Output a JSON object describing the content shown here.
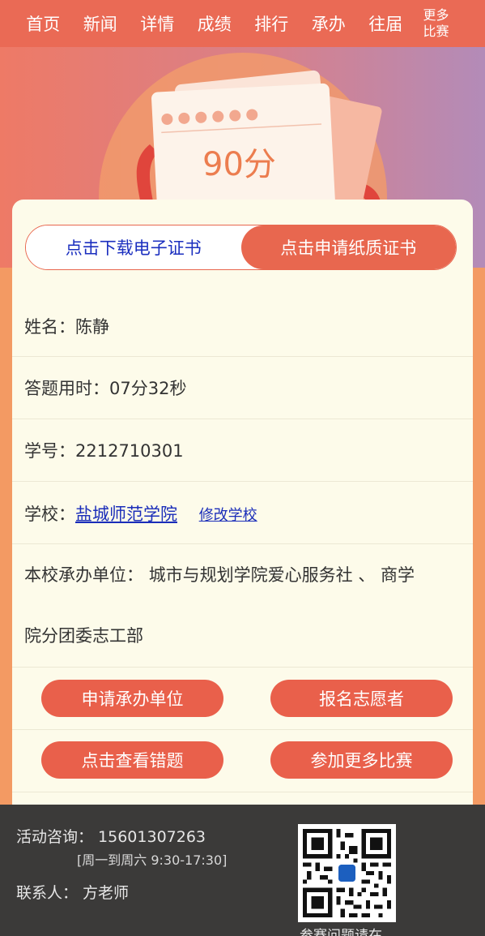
{
  "nav": {
    "items": [
      "首页",
      "新闻",
      "详情",
      "成绩",
      "排行",
      "承办",
      "往届"
    ],
    "more_line1": "更多",
    "more_line2": "比赛"
  },
  "hero": {
    "score": "90分"
  },
  "cert": {
    "download_label": "点击下载电子证书",
    "apply_label": "点击申请纸质证书"
  },
  "info": {
    "name_label": "姓名：",
    "name_value": "陈静",
    "time_label": "答题用时：",
    "time_value": "07分32秒",
    "id_label": "学号：",
    "id_value": "2212710301",
    "school_label": "学校：",
    "school_value": "盐城师范学院",
    "edit_school": "修改学校",
    "host_label": "本校承办单位：",
    "host_line1_value": "城市与规划学院爱心服务社 、 商学",
    "host_line2_value": "院分团委志工部"
  },
  "actions": {
    "apply_host": "申请承办单位",
    "volunteer": "报名志愿者",
    "view_wrong": "点击查看错题",
    "more_contests": "参加更多比赛"
  },
  "footer": {
    "consult": "活动咨询：  15601307263",
    "hours": "[周一到周六 9:30-17:30]",
    "contact": "联系人：  方老师",
    "qr_caption": "参赛问题请在"
  },
  "colors": {
    "nav_bg": "#ea6a55",
    "accent": "#e9604b",
    "card_bg": "#fdfbea",
    "link": "#1a2db9",
    "footer_bg": "#3b3a39"
  }
}
